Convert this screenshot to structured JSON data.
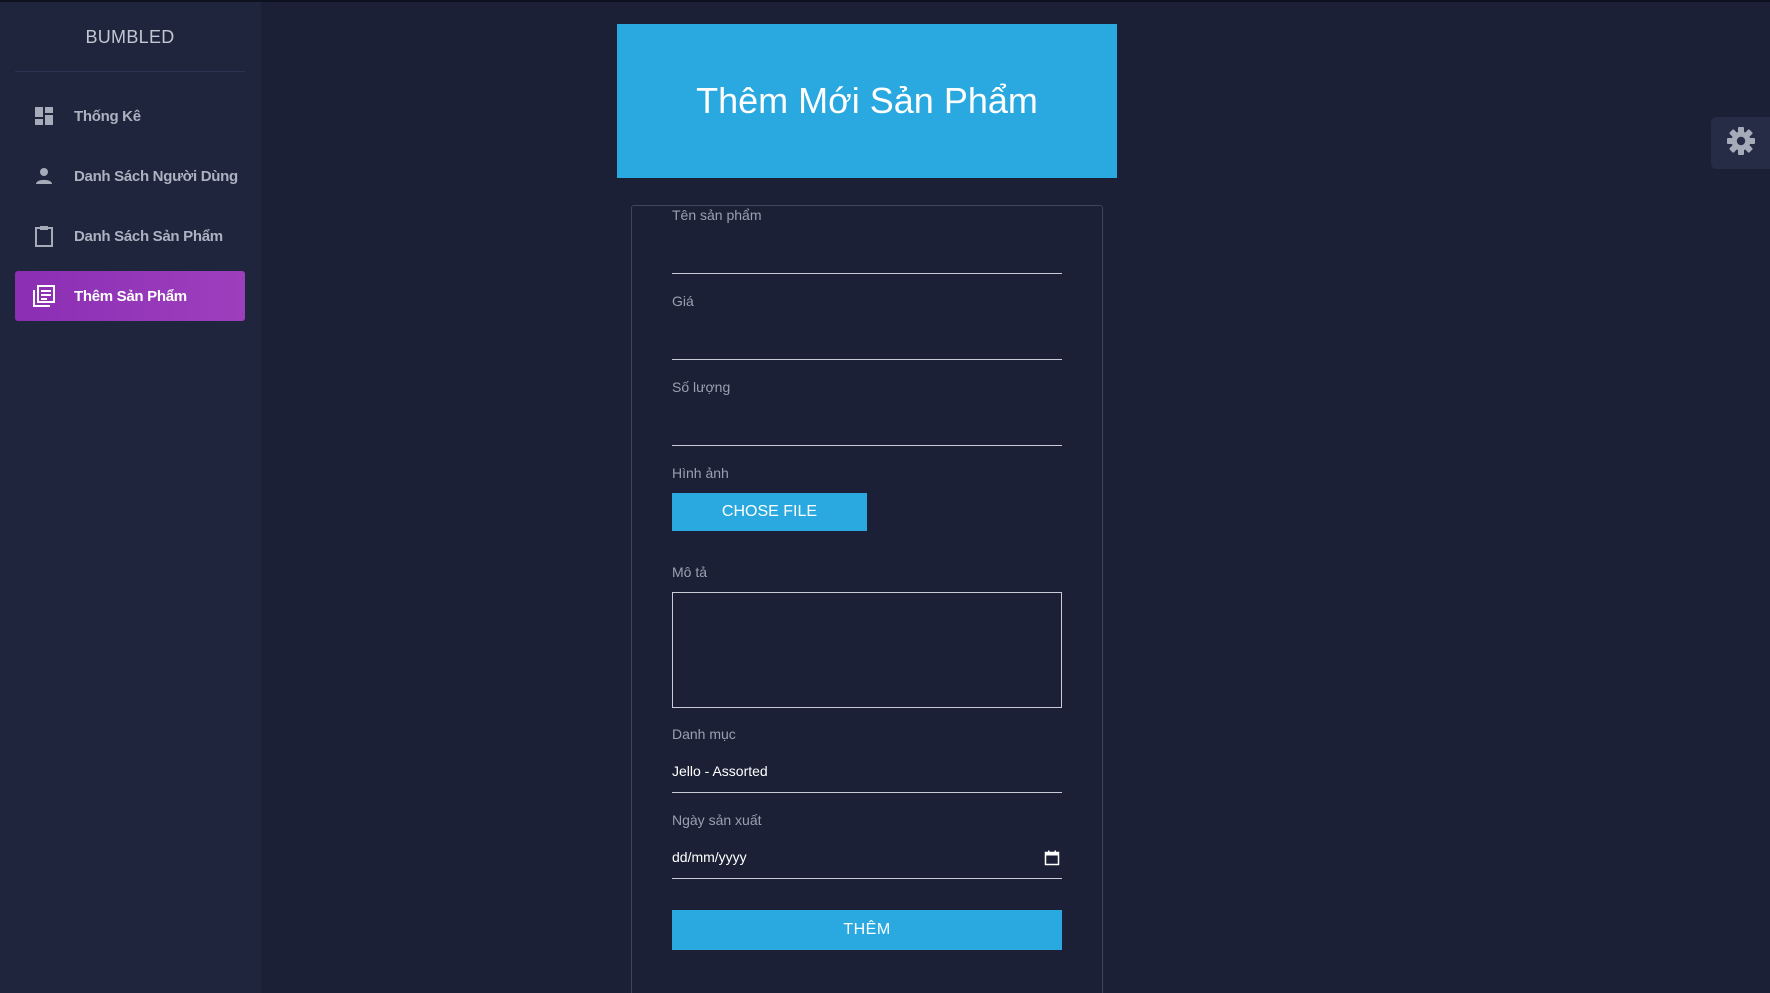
{
  "brand": "BUMBLED",
  "sidebar": {
    "items": [
      {
        "label": "Thống Kê",
        "icon": "dashboard-icon"
      },
      {
        "label": "Danh Sách Người Dùng",
        "icon": "person-icon"
      },
      {
        "label": "Danh Sách Sản Phẩm",
        "icon": "clipboard-icon"
      },
      {
        "label": "Thêm Sản Phẩm",
        "icon": "library-books-icon",
        "active": true
      }
    ]
  },
  "header": {
    "title": "Thêm Mới Sản Phẩm"
  },
  "form": {
    "name_label": "Tên sản phẩm",
    "price_label": "Giá",
    "quantity_label": "Số lượng",
    "image_label": "Hình ảnh",
    "choose_file_label": "CHOSE FILE",
    "description_label": "Mô tả",
    "category_label": "Danh mục",
    "category_value": "Jello - Assorted",
    "date_label": "Ngày sản xuất",
    "date_placeholder": "dd/mm/yyyy",
    "submit_label": "THÊM"
  },
  "settings": {
    "icon": "gear-icon"
  },
  "colors": {
    "background": "#1b2036",
    "sidebar": "#1f253c",
    "accent": "#29a9e0",
    "active_nav": "#9531b9"
  }
}
